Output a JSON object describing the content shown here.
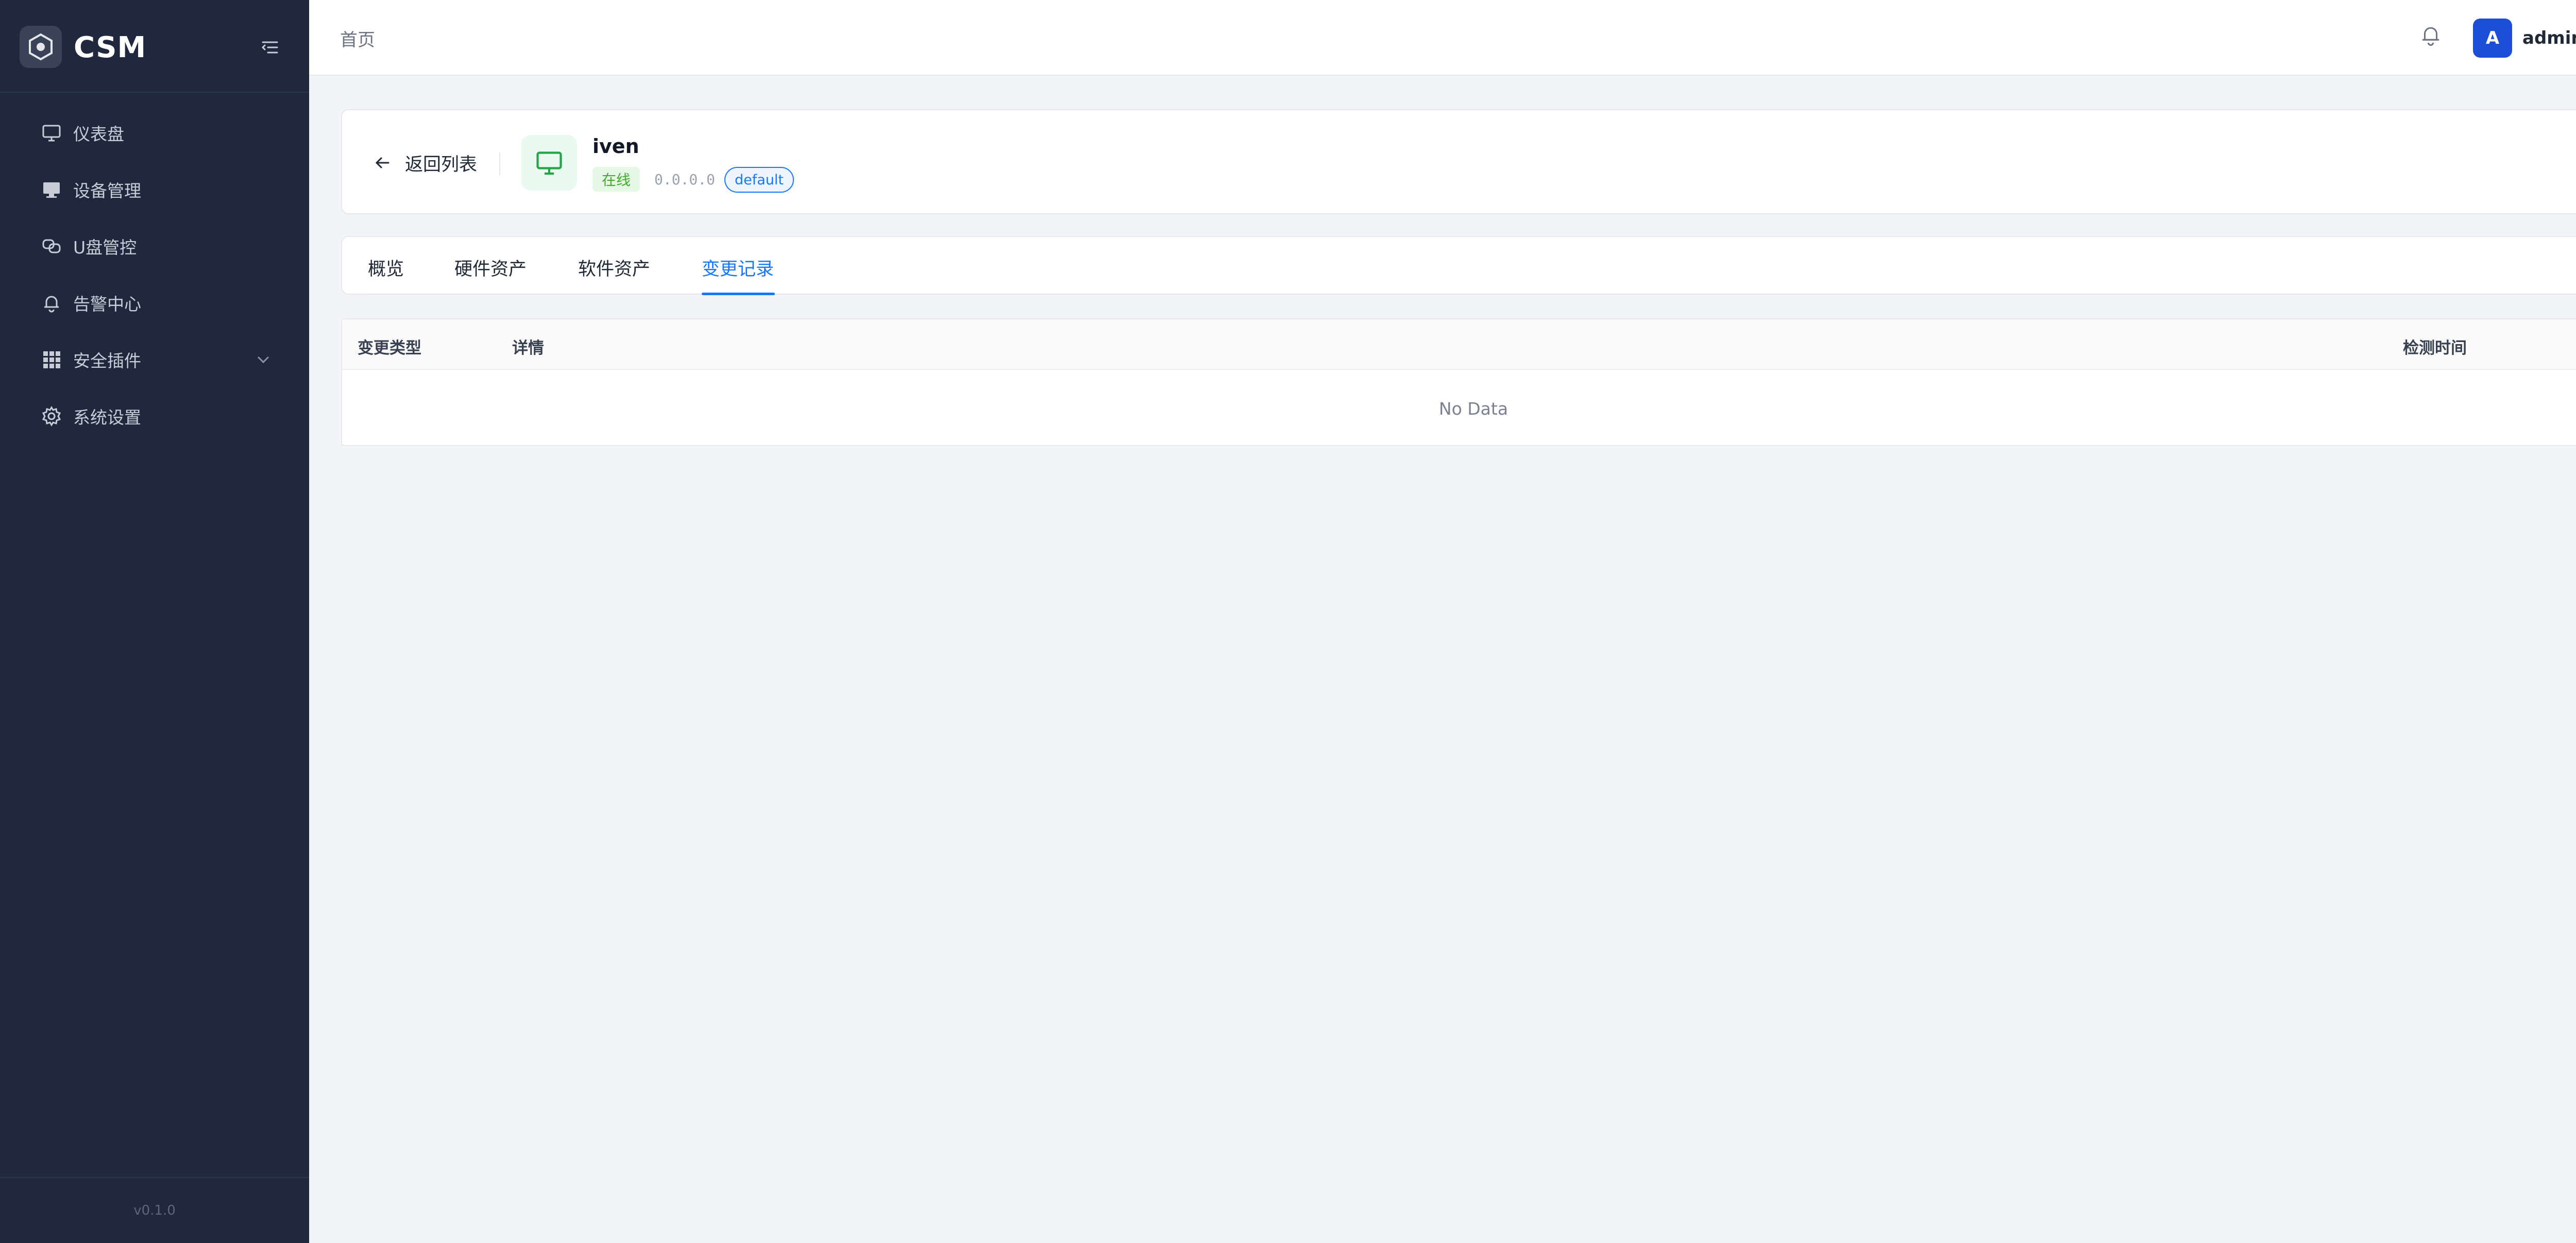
{
  "app": {
    "name": "CSM",
    "version": "v0.1.0"
  },
  "sidebar": {
    "items": [
      {
        "label": "仪表盘",
        "icon": "monitor-icon"
      },
      {
        "label": "设备管理",
        "icon": "desktop-icon"
      },
      {
        "label": "U盘管控",
        "icon": "usb-icon"
      },
      {
        "label": "告警中心",
        "icon": "bell-icon"
      },
      {
        "label": "安全插件",
        "icon": "grid-icon",
        "has_submenu": true
      },
      {
        "label": "系统设置",
        "icon": "gear-icon"
      }
    ]
  },
  "header": {
    "breadcrumb": "首页",
    "user": {
      "avatar_letter": "A",
      "name": "admin"
    }
  },
  "device": {
    "back_label": "返回列表",
    "name": "iven",
    "status": "在线",
    "ip": "0.0.0.0",
    "group": "default"
  },
  "tabs": {
    "items": [
      "概览",
      "硬件资产",
      "软件资产",
      "变更记录"
    ],
    "active": "变更记录"
  },
  "table": {
    "columns": [
      "变更类型",
      "详情",
      "检测时间"
    ],
    "rows": [],
    "empty_text": "No Data"
  },
  "colors": {
    "sidebar_bg": "#1f283d",
    "accent": "#1677ff",
    "online_green": "#3fae2b",
    "avatar_blue": "#1d4ed8"
  }
}
